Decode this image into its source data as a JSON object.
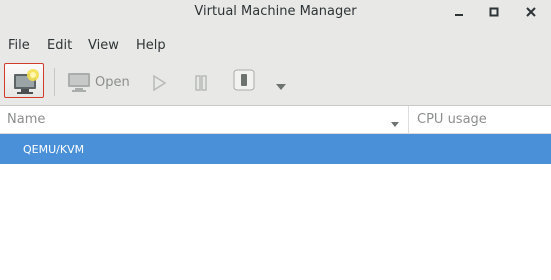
{
  "window": {
    "title": "Virtual Machine Manager"
  },
  "menubar": {
    "items": [
      "File",
      "Edit",
      "View",
      "Help"
    ]
  },
  "toolbar": {
    "open_label": "Open"
  },
  "columns": {
    "name": "Name",
    "cpu_usage": "CPU usage"
  },
  "connections": [
    {
      "label": "QEMU/KVM",
      "selected": true
    }
  ],
  "colors": {
    "selection": "#4a90d9",
    "highlight_border": "#d13b2a",
    "chrome": "#e8e8e7"
  }
}
